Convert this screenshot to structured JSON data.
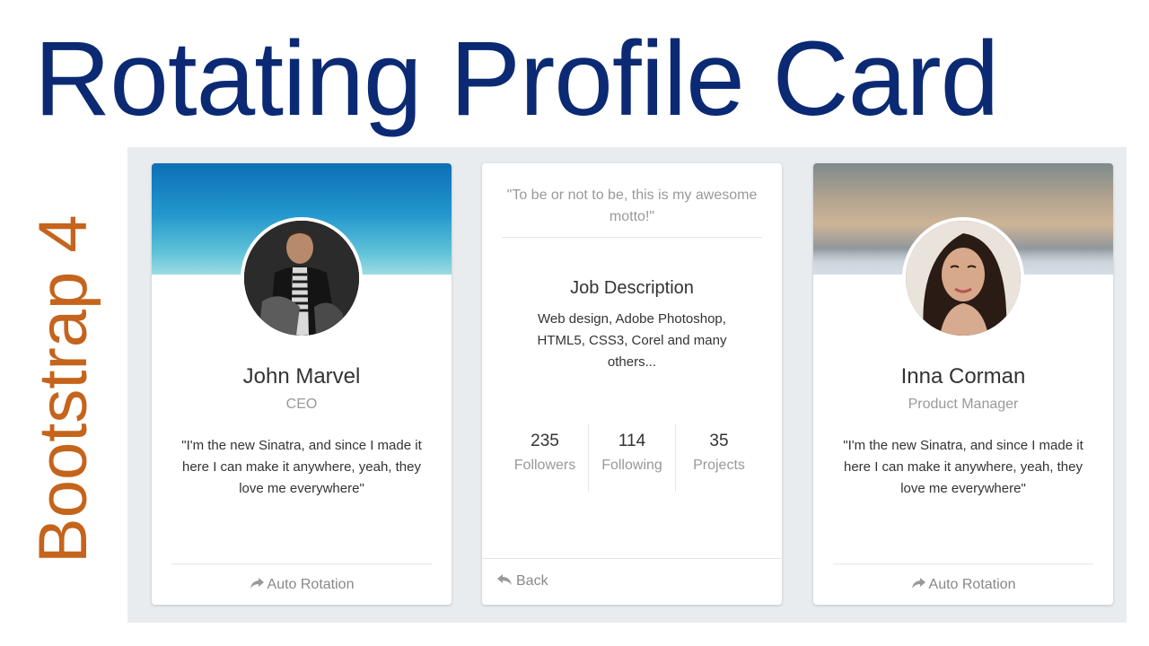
{
  "page": {
    "title": "Rotating Profile Card",
    "side_title": "Bootstrap 4"
  },
  "colors": {
    "title": "#0b2a73",
    "side_title": "#c5641c",
    "stage_bg": "#e9ecef"
  },
  "cards": [
    {
      "name": "John Marvel",
      "role": "CEO",
      "quote": "\"I'm the new Sinatra, and since I made it here I can make it anywhere, yeah, they love me everywhere\"",
      "footer_label": "Auto Rotation",
      "footer_icon": "share-icon"
    },
    {
      "motto": "\"To be or not to be, this is my awesome motto!\"",
      "job_title": "Job Description",
      "job_text": "Web design, Adobe Photoshop, HTML5, CSS3, Corel and many others...",
      "stats": [
        {
          "value": "235",
          "label": "Followers"
        },
        {
          "value": "114",
          "label": "Following"
        },
        {
          "value": "35",
          "label": "Projects"
        }
      ],
      "back_label": "Back",
      "back_icon": "reply-icon"
    },
    {
      "name": "Inna Corman",
      "role": "Product Manager",
      "quote": "\"I'm the new Sinatra, and since I made it here I can make it anywhere, yeah, they love me everywhere\"",
      "footer_label": "Auto Rotation",
      "footer_icon": "share-icon"
    }
  ]
}
